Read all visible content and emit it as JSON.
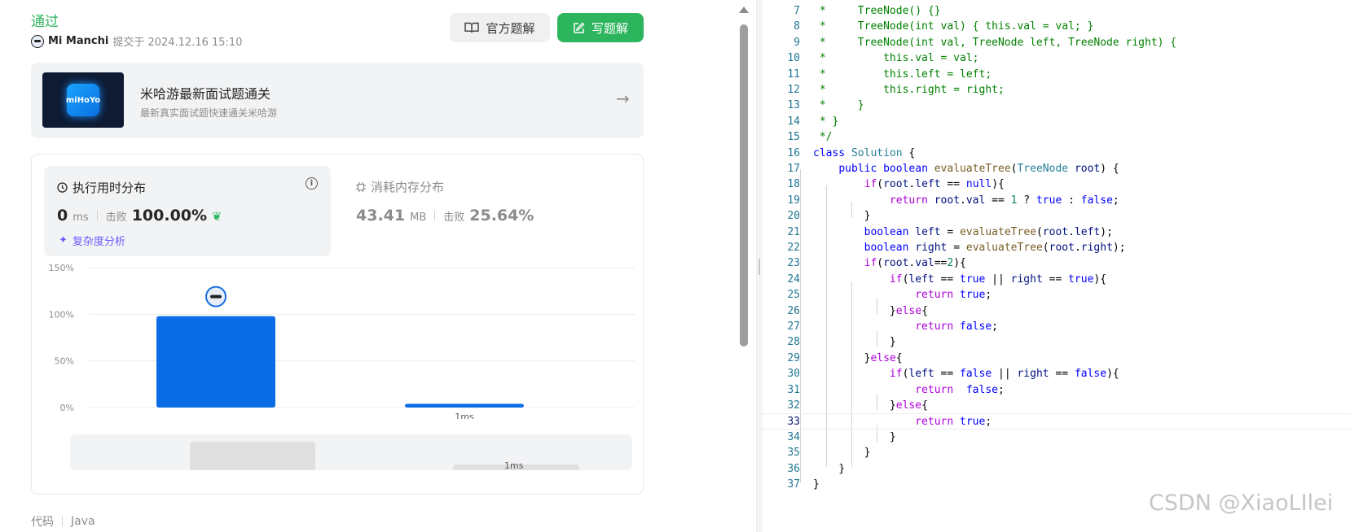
{
  "submission": {
    "status": "通过",
    "user": "Mi Manchi",
    "submitted_at": "提交于 2024.12.16 15:10",
    "official_solution_label": "官方题解",
    "write_solution_label": "写题解"
  },
  "banner": {
    "image_text": "miHoYo",
    "title": "米哈游最新面试题通关",
    "subtitle": "最新真实面试题快速通关米哈游"
  },
  "runtime": {
    "title": "执行用时分布",
    "value": "0",
    "unit": "ms",
    "beat_label": "击败",
    "beat_pct": "100.00%",
    "analysis_label": "复杂度分析"
  },
  "memory": {
    "title": "消耗内存分布",
    "value": "43.41",
    "unit": "MB",
    "beat_label": "击败",
    "beat_pct": "25.64%"
  },
  "chart_data": {
    "type": "bar",
    "categories": [
      "",
      "1ms"
    ],
    "values": [
      98,
      4
    ],
    "yticks": [
      "0%",
      "50%",
      "100%",
      "150%"
    ],
    "ylim": [
      0,
      150
    ],
    "color": "#0a6de6",
    "grid": true
  },
  "overview": {
    "label": "1ms"
  },
  "footer": {
    "code_label": "代码",
    "language": "Java"
  },
  "editor": {
    "active_line": 33,
    "lines": [
      {
        "n": "7",
        "t": " *     TreeNode() {}"
      },
      {
        "n": "8",
        "t": " *     TreeNode(int val) { this.val = val; }"
      },
      {
        "n": "9",
        "t": " *     TreeNode(int val, TreeNode left, TreeNode right) {"
      },
      {
        "n": "10",
        "t": " *         this.val = val;"
      },
      {
        "n": "11",
        "t": " *         this.left = left;"
      },
      {
        "n": "12",
        "t": " *         this.right = right;"
      },
      {
        "n": "13",
        "t": " *     }"
      },
      {
        "n": "14",
        "t": " * }"
      },
      {
        "n": "15",
        "t": " */"
      },
      {
        "n": "16",
        "t": "class Solution {"
      },
      {
        "n": "17",
        "t": "    public boolean evaluateTree(TreeNode root) {"
      },
      {
        "n": "18",
        "t": "        if(root.left == null){"
      },
      {
        "n": "19",
        "t": "            return root.val == 1 ? true : false;"
      },
      {
        "n": "20",
        "t": "        }"
      },
      {
        "n": "21",
        "t": "        boolean left = evaluateTree(root.left);"
      },
      {
        "n": "22",
        "t": "        boolean right = evaluateTree(root.right);"
      },
      {
        "n": "23",
        "t": "        if(root.val==2){"
      },
      {
        "n": "24",
        "t": "            if(left == true || right == true){"
      },
      {
        "n": "25",
        "t": "                return true;"
      },
      {
        "n": "26",
        "t": "            }else{"
      },
      {
        "n": "27",
        "t": "                return false;"
      },
      {
        "n": "28",
        "t": "            }"
      },
      {
        "n": "29",
        "t": "        }else{"
      },
      {
        "n": "30",
        "t": "            if(left == false || right == false){"
      },
      {
        "n": "31",
        "t": "                return  false;"
      },
      {
        "n": "32",
        "t": "            }else{"
      },
      {
        "n": "33",
        "t": "                return true;"
      },
      {
        "n": "34",
        "t": "            }"
      },
      {
        "n": "35",
        "t": "        }"
      },
      {
        "n": "36",
        "t": "    }"
      },
      {
        "n": "37",
        "t": "}"
      }
    ]
  },
  "watermark": "CSDN @XiaoLIlei"
}
